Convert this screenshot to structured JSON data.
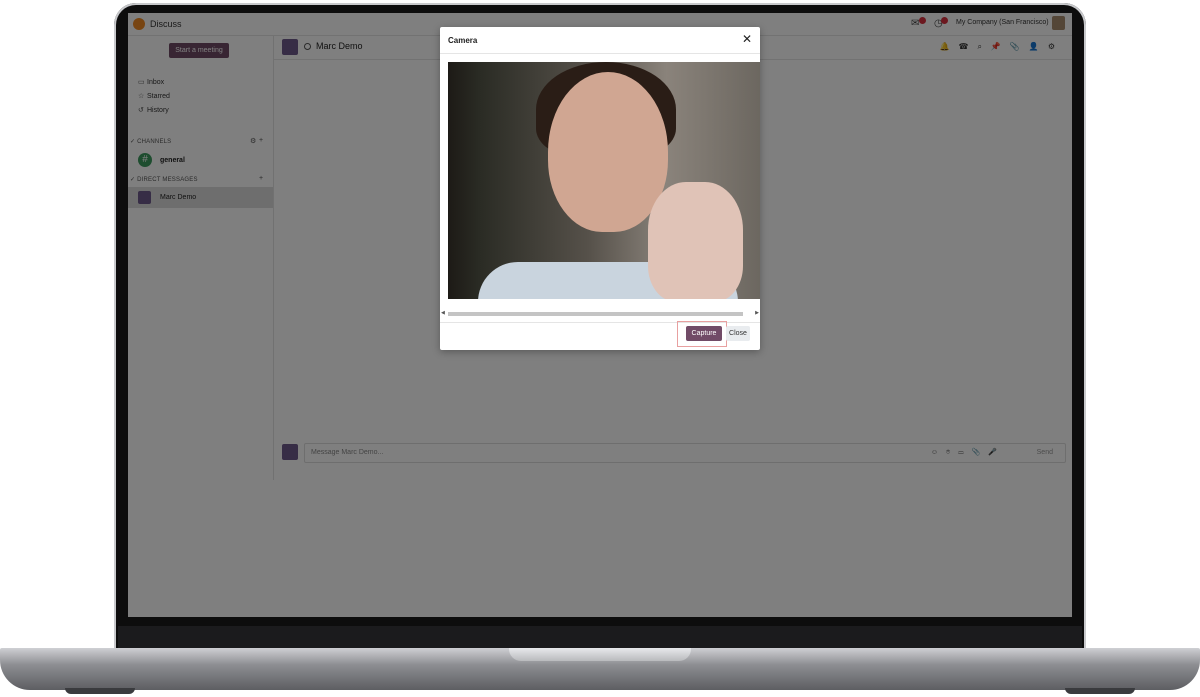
{
  "app": {
    "title": "Discuss"
  },
  "systray": {
    "company": "My Company (San Francisco)"
  },
  "sidebar": {
    "start_meeting": "Start a meeting",
    "items": [
      {
        "label": "Inbox",
        "icon": "inbox-icon"
      },
      {
        "label": "Starred",
        "icon": "star-icon"
      },
      {
        "label": "History",
        "icon": "history-icon"
      }
    ],
    "channels_header": "CHANNELS",
    "channels": [
      {
        "label": "general"
      }
    ],
    "dm_header": "DIRECT MESSAGES",
    "direct_messages": [
      {
        "label": "Marc Demo"
      }
    ]
  },
  "thread": {
    "title": "Marc Demo"
  },
  "composer": {
    "placeholder": "Message Marc Demo...",
    "send_label": "Send"
  },
  "dialog": {
    "title": "Camera",
    "capture_label": "Capture",
    "close_label": "Close"
  }
}
